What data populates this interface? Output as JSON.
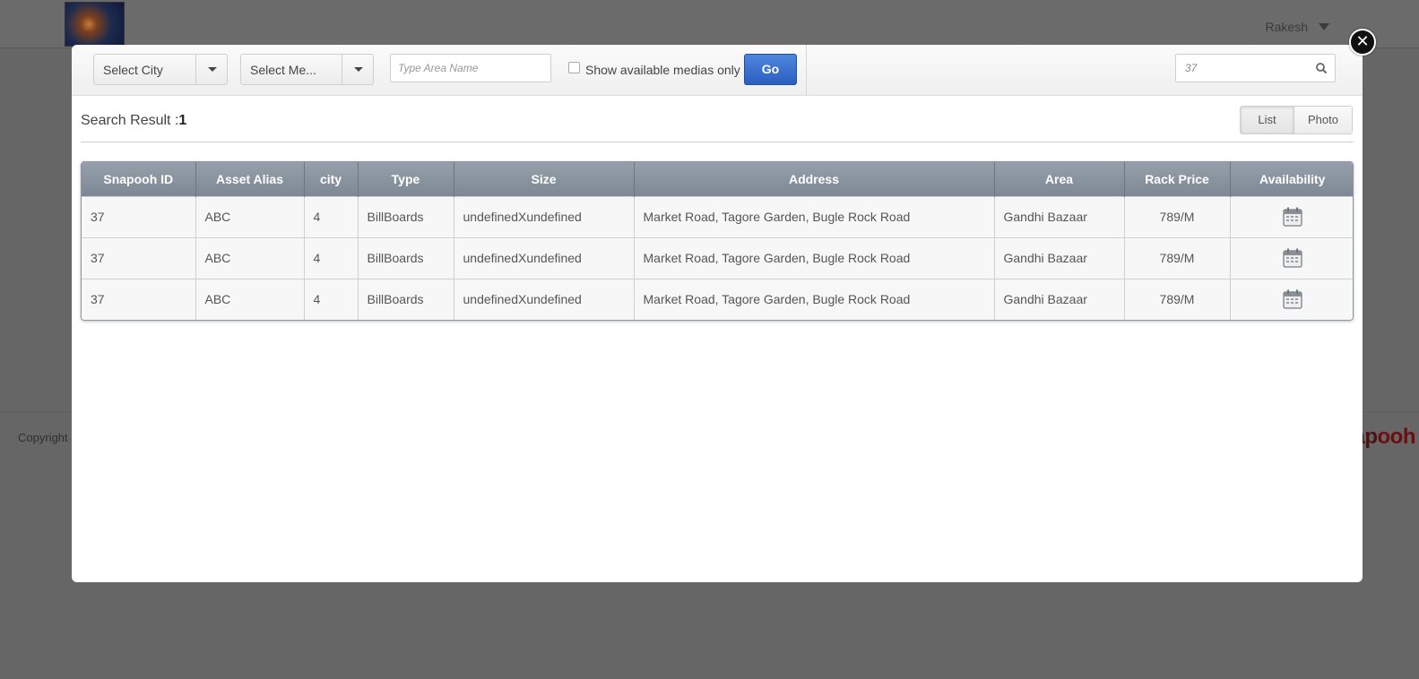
{
  "header": {
    "user_name": "Rakesh"
  },
  "footer": {
    "copyright": "Copyright",
    "brand_part1": "ap",
    "brand_part2": "ooh"
  },
  "filters": {
    "city_select": "Select City",
    "media_select": "Select Me...",
    "area_placeholder": "Type Area Name",
    "available_only_label": "Show available medias only",
    "go_label": "Go",
    "search_value": "37"
  },
  "results": {
    "title": "Search Result :",
    "count": "1",
    "view_list": "List",
    "view_photo": "Photo"
  },
  "table": {
    "headers": [
      "Snapooh ID",
      "Asset Alias",
      "city",
      "Type",
      "Size",
      "Address",
      "Area",
      "Rack Price",
      "Availability"
    ],
    "rows": [
      [
        "37",
        "ABC",
        "4",
        "BillBoards",
        "undefinedXundefined",
        "Market Road, Tagore Garden, Bugle Rock Road",
        "Gandhi Bazaar",
        "789/M"
      ],
      [
        "37",
        "ABC",
        "4",
        "BillBoards",
        "undefinedXundefined",
        "Market Road, Tagore Garden, Bugle Rock Road",
        "Gandhi Bazaar",
        "789/M"
      ],
      [
        "37",
        "ABC",
        "4",
        "BillBoards",
        "undefinedXundefined",
        "Market Road, Tagore Garden, Bugle Rock Road",
        "Gandhi Bazaar",
        "789/M"
      ]
    ]
  },
  "icons": {
    "close": "close-icon",
    "search": "search-icon",
    "availability": "calendar-icon",
    "dropdown": "chevron-down-icon"
  }
}
